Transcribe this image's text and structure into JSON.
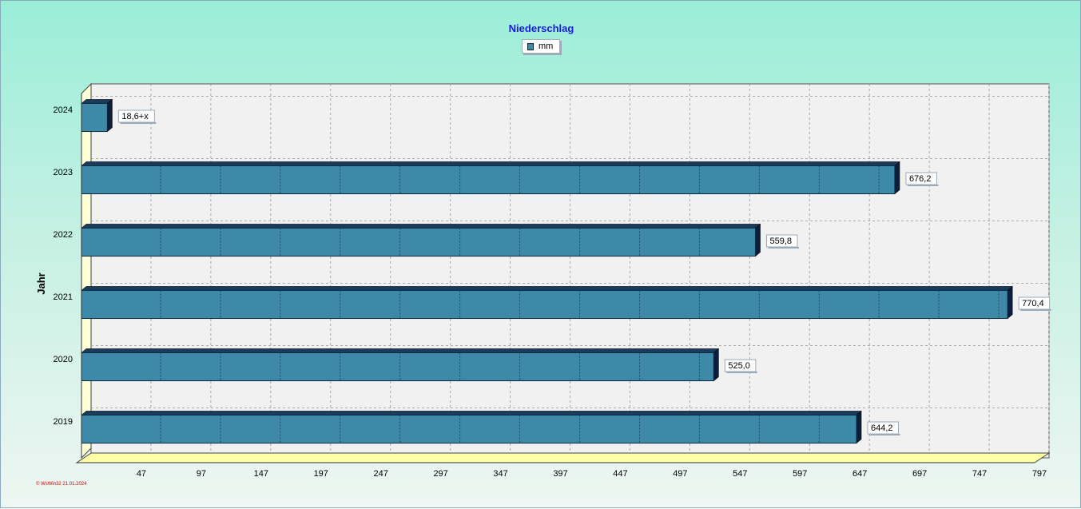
{
  "chart_data": {
    "type": "bar",
    "orientation": "horizontal",
    "title": "Niederschlag",
    "ylabel": "Jahr",
    "xlabel": "",
    "legend": {
      "position": "top-center",
      "entries": [
        "mm"
      ]
    },
    "categories": [
      "2024",
      "2023",
      "2022",
      "2021",
      "2020",
      "2019"
    ],
    "series": [
      {
        "name": "mm",
        "values": [
          18.6,
          676.2,
          559.8,
          770.4,
          525.0,
          644.2
        ],
        "labels": [
          "18,6+x",
          "676,2",
          "559,8",
          "770,4",
          "525,0",
          "644,2"
        ]
      }
    ],
    "x_ticks": [
      47,
      97,
      147,
      197,
      247,
      297,
      347,
      397,
      447,
      497,
      547,
      597,
      647,
      697,
      747,
      797
    ],
    "xlim": [
      -3,
      797
    ],
    "grid": true,
    "colors": {
      "bar": "#3e88a8",
      "bar_dark": "#0c1e3c",
      "title": "#1a1ae0",
      "floor": "#ffffa8"
    }
  },
  "footer": "© WsWin32 21.01.2024"
}
